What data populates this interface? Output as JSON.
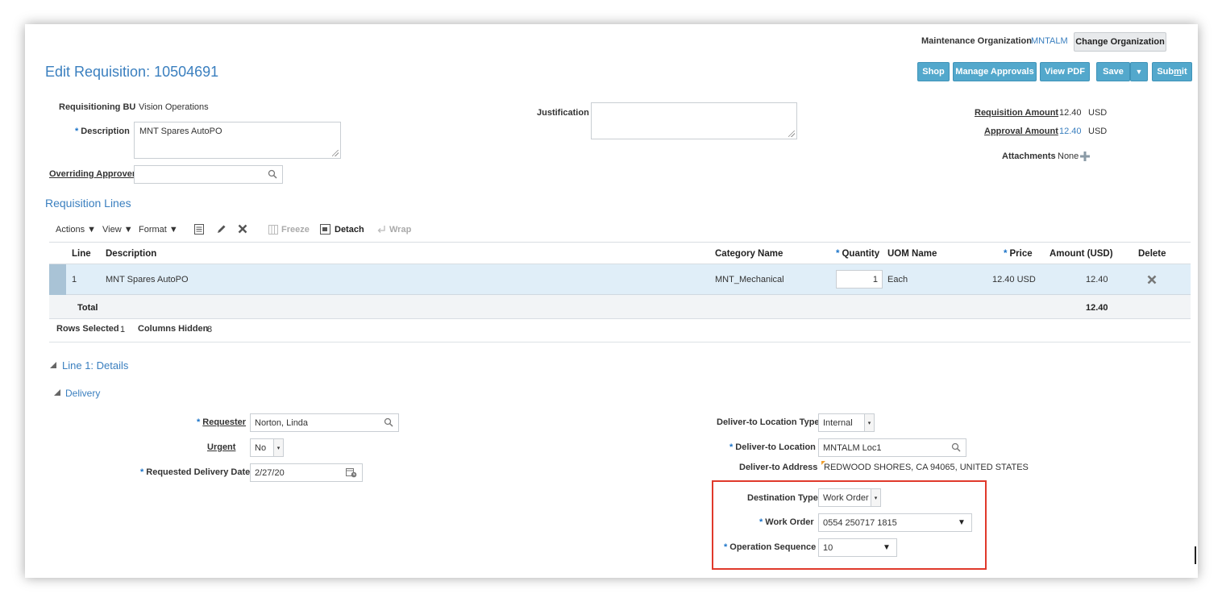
{
  "header": {
    "maintenance_org_label": "Maintenance Organization",
    "maintenance_org_value": "MNTALM",
    "change_org_button": "Change Organization",
    "page_title": "Edit Requisition: 10504691"
  },
  "actions": {
    "shop": "Shop",
    "manage_approvals": "Manage Approvals",
    "view_pdf": "View PDF",
    "save": "Save",
    "save_menu_caret": "▼",
    "submit_pre": "Sub",
    "submit_underline": "m",
    "submit_post": "it"
  },
  "form": {
    "requisitioning_bu_label": "Requisitioning BU",
    "requisitioning_bu_value": "Vision Operations",
    "description_label": "Description",
    "description_value": "MNT Spares AutoPO",
    "overriding_approver_label": "Overriding Approver",
    "overriding_approver_value": "",
    "justification_label": "Justification",
    "justification_value": "",
    "requisition_amount_label": "Requisition Amount",
    "requisition_amount_value": "12.40",
    "requisition_amount_currency": "USD",
    "approval_amount_label": "Approval Amount",
    "approval_amount_value": "12.40",
    "approval_amount_currency": "USD",
    "attachments_label": "Attachments",
    "attachments_value": "None"
  },
  "lines": {
    "section_title": "Requisition Lines",
    "toolbar": {
      "actions": "Actions ▼",
      "view": "View ▼",
      "format": "Format ▼",
      "freeze": "Freeze",
      "detach": "Detach",
      "wrap": "Wrap"
    },
    "columns": {
      "line": "Line",
      "description": "Description",
      "category": "Category Name",
      "quantity": "Quantity",
      "uom": "UOM Name",
      "price": "Price",
      "amount": "Amount (USD)",
      "delete": "Delete"
    },
    "rows": [
      {
        "line": "1",
        "description": "MNT Spares AutoPO",
        "category": "MNT_Mechanical",
        "quantity": "1",
        "uom": "Each",
        "price": "12.40 USD",
        "amount": "12.40"
      }
    ],
    "total_label": "Total",
    "total_amount": "12.40",
    "rows_selected_label": "Rows Selected",
    "rows_selected_value": "1",
    "columns_hidden_label": "Columns Hidden",
    "columns_hidden_value": "8"
  },
  "details": {
    "line_details_title": "Line 1: Details",
    "delivery_title": "Delivery",
    "requester_label": "Requester",
    "requester_value": "Norton, Linda",
    "urgent_label": "Urgent",
    "urgent_value": "No",
    "requested_delivery_date_label": "Requested Delivery Date",
    "requested_delivery_date_value": "2/27/20",
    "deliver_to_location_type_label": "Deliver-to Location Type",
    "deliver_to_location_type_value": "Internal",
    "deliver_to_location_label": "Deliver-to Location",
    "deliver_to_location_value": "MNTALM Loc1",
    "deliver_to_address_label": "Deliver-to Address",
    "deliver_to_address_value": "REDWOOD SHORES, CA 94065, UNITED STATES",
    "destination_type_label": "Destination Type",
    "destination_type_value": "Work Order",
    "work_order_label": "Work Order",
    "work_order_value": "0554 250717 1815",
    "operation_sequence_label": "Operation Sequence",
    "operation_sequence_value": "10"
  },
  "glyphs": {
    "required_star": "*",
    "small_caret": "▾",
    "big_caret": "▼"
  },
  "colors": {
    "accent_blue": "#3a7fbf",
    "button_blue": "#53a8cc",
    "selected_row": "#e0eef8",
    "highlight_red": "#e0392b"
  }
}
